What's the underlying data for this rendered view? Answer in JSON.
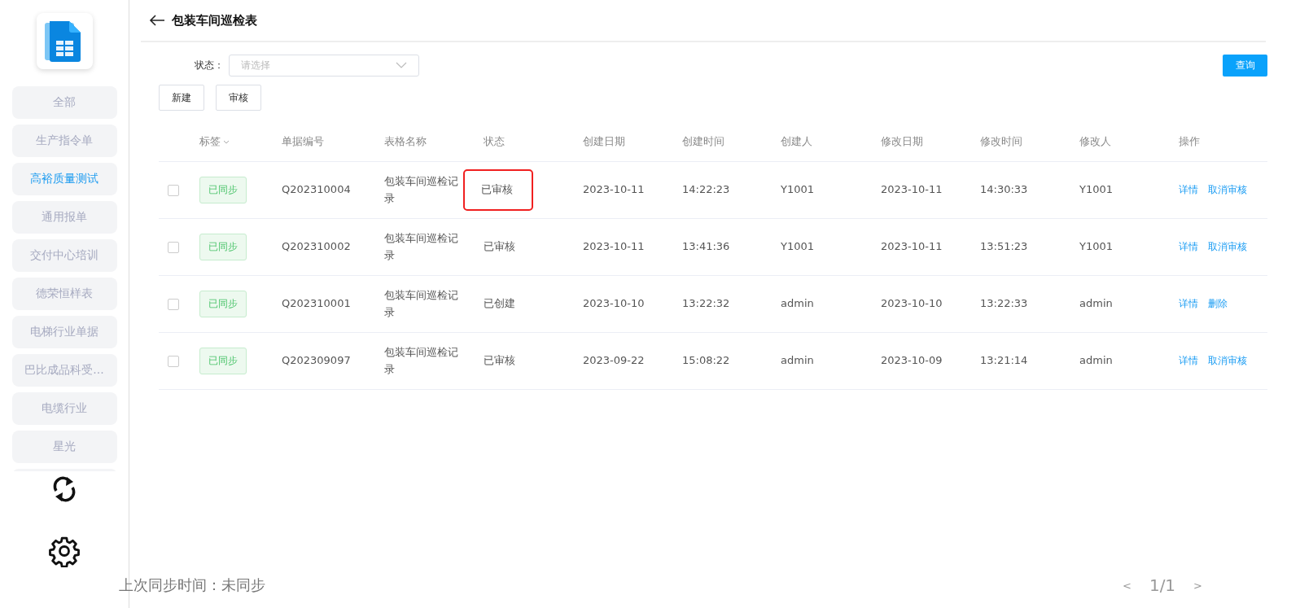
{
  "sidebar": {
    "items": [
      {
        "label": "全部",
        "selected": false
      },
      {
        "label": "生产指令单",
        "selected": false
      },
      {
        "label": "高裕质量测试",
        "selected": true
      },
      {
        "label": "通用报单",
        "selected": false
      },
      {
        "label": "交付中心培训",
        "selected": false
      },
      {
        "label": "德荣恒样表",
        "selected": false
      },
      {
        "label": "电梯行业单据",
        "selected": false
      },
      {
        "label": "巴比成品科受...",
        "selected": false
      },
      {
        "label": "电缆行业",
        "selected": false
      },
      {
        "label": "星光",
        "selected": false
      }
    ]
  },
  "header": {
    "title": "包装车间巡检表"
  },
  "filter": {
    "label": "状态：",
    "placeholder": "请选择",
    "search_button": "查询"
  },
  "toolbar": [
    "新建",
    "审核"
  ],
  "table": {
    "columns": [
      "标签",
      "单据编号",
      "表格名称",
      "状态",
      "创建日期",
      "创建时间",
      "创建人",
      "修改日期",
      "修改时间",
      "修改人",
      "操作"
    ],
    "rows": [
      {
        "checked": false,
        "tag": "已同步",
        "number": "Q202310004",
        "form_name": "包装车间巡检记录",
        "status": "已审核",
        "status_highlighted": true,
        "created_date": "2023-10-11",
        "created_time": "14:22:23",
        "creator": "Y1001",
        "modified_date": "2023-10-11",
        "modified_time": "14:30:33",
        "modifier": "Y1001",
        "actions": [
          "详情",
          "取消审核"
        ]
      },
      {
        "checked": false,
        "tag": "已同步",
        "number": "Q202310002",
        "form_name": "包装车间巡检记录",
        "status": "已审核",
        "status_highlighted": false,
        "created_date": "2023-10-11",
        "created_time": "13:41:36",
        "creator": "Y1001",
        "modified_date": "2023-10-11",
        "modified_time": "13:51:23",
        "modifier": "Y1001",
        "actions": [
          "详情",
          "取消审核"
        ]
      },
      {
        "checked": false,
        "tag": "已同步",
        "number": "Q202310001",
        "form_name": "包装车间巡检记录",
        "status": "已创建",
        "status_highlighted": false,
        "created_date": "2023-10-10",
        "created_time": "13:22:32",
        "creator": "admin",
        "modified_date": "2023-10-10",
        "modified_time": "13:22:33",
        "modifier": "admin",
        "actions": [
          "详情",
          "删除"
        ]
      },
      {
        "checked": false,
        "tag": "已同步",
        "number": "Q202309097",
        "form_name": "包装车间巡检记录",
        "status": "已审核",
        "status_highlighted": false,
        "created_date": "2023-09-22",
        "created_time": "15:08:22",
        "creator": "admin",
        "modified_date": "2023-10-09",
        "modified_time": "13:21:14",
        "modifier": "admin",
        "actions": [
          "详情",
          "取消审核"
        ]
      }
    ]
  },
  "footer": {
    "sync_status": "上次同步时间：未同步",
    "pagination": {
      "prev": "<",
      "page": "1/1",
      "next": ">"
    }
  }
}
